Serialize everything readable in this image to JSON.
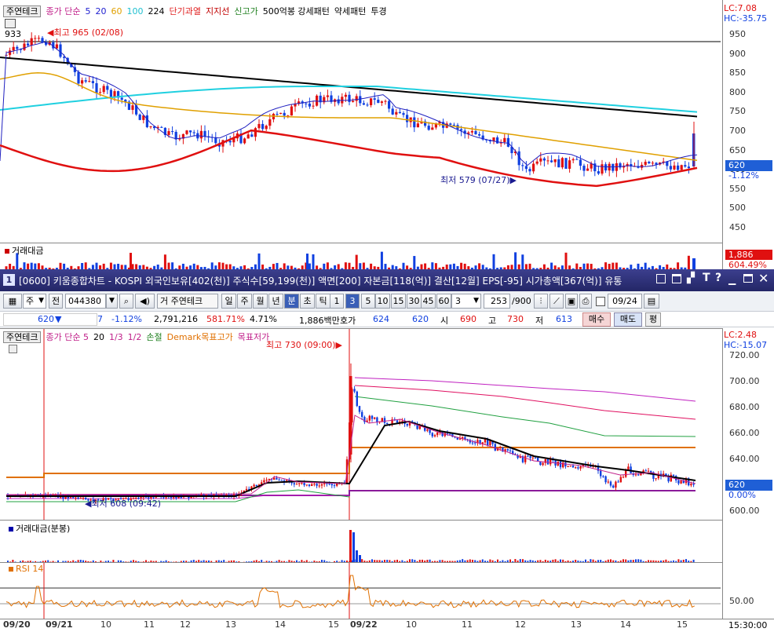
{
  "top_chart": {
    "legend": {
      "button": "주연테크",
      "items": [
        {
          "text": "종가 단순",
          "color": "#c0208a"
        },
        {
          "text": "5",
          "color": "#2020d0"
        },
        {
          "text": "20",
          "color": "#2020d0"
        },
        {
          "text": "60",
          "color": "#e0a000"
        },
        {
          "text": "100",
          "color": "#20c0d0"
        },
        {
          "text": "224",
          "color": "#000000"
        },
        {
          "text": "단기과열",
          "color": "#e02020"
        },
        {
          "text": "지지선",
          "color": "#c00000"
        },
        {
          "text": "신고가",
          "color": "#208020"
        },
        {
          "text": "500억봉 강세패턴",
          "color": "#000000"
        },
        {
          "text": "약세패턴",
          "color": "#000000"
        },
        {
          "text": "투경",
          "color": "#000000"
        }
      ]
    },
    "corner_value": "933",
    "high_label": "최고 965 (02/08)",
    "low_label": "최저 579 (07/27)",
    "lc": "LC:7.08",
    "hc": "HC:-35.75",
    "y_ticks": [
      "950",
      "900",
      "850",
      "800",
      "750",
      "700",
      "650",
      "600",
      "550",
      "500",
      "450"
    ],
    "price_box": "620",
    "pct_label": "-1.12%",
    "volume_title": "거래대금",
    "volume_box": "1,886",
    "volume_pct": "604.49%"
  },
  "window": {
    "number": "1",
    "title": "[0600] 키움종합차트 - KOSPI 외국인보유[402(천)] 주식수[59,199(천)] 액면[200] 자본금[118(억)] 결산[12월] EPS[-95] 시가총액[367(억)] 유통"
  },
  "toolbar": {
    "type_select": "주",
    "prev_btn": "전",
    "code_input": "044380",
    "stock_name": "거 주연테크",
    "period_tabs": [
      "일",
      "주",
      "월",
      "년",
      "분",
      "초",
      "틱"
    ],
    "active_period": "분",
    "minute_tabs": [
      "1",
      "3",
      "5",
      "10",
      "15",
      "30",
      "45",
      "60"
    ],
    "active_minute": "3",
    "count_select": "3",
    "data_count": "253",
    "data_total": "/900",
    "date_input": "09/24"
  },
  "quote": {
    "price": "620",
    "arrow": "▼",
    "change": "7",
    "change_pct": "-1.12%",
    "volume": "2,791,216",
    "vol_ratio": "581.71%",
    "turnover": "4.71%",
    "amount": "1,886백만",
    "bid_label": "호가",
    "bid": "624",
    "ask": "620",
    "open_label": "시",
    "open": "690",
    "high_label": "고",
    "high": "730",
    "low_label": "저",
    "low": "613",
    "buy_button": "매수",
    "sell_button": "매도",
    "eval_button": "평"
  },
  "bottom_chart": {
    "legend": {
      "button": "주연테크",
      "items": [
        {
          "text": "종가 단순 5",
          "color": "#c0208a"
        },
        {
          "text": "20",
          "color": "#000000"
        },
        {
          "text": "1/3",
          "color": "#c0208a"
        },
        {
          "text": "1/2",
          "color": "#c0208a"
        },
        {
          "text": "손절",
          "color": "#208020"
        },
        {
          "text": "Demark목표고가",
          "color": "#e07000"
        },
        {
          "text": "목표저가",
          "color": "#c0208a"
        }
      ]
    },
    "high_label": "최고 730 (09:00)",
    "low_label": "최저 608 (09:42)",
    "lc": "LC:2.48",
    "hc": "HC:-15.07",
    "y_ticks": [
      "720.00",
      "700.00",
      "680.00",
      "660.00",
      "640.00",
      "620",
      "0.00%",
      "600.00"
    ],
    "volume_title": "거래대금(분봉)",
    "rsi_title": "RSI 14",
    "rsi_tick": "50.00",
    "x_labels": [
      "09/20",
      "09/21",
      "10",
      "11",
      "12",
      "13",
      "14",
      "15",
      "09/22",
      "10",
      "11",
      "12",
      "13",
      "14",
      "15"
    ],
    "time_label": "15:30:00"
  },
  "colors": {
    "up": "#e01010",
    "down": "#1040e0",
    "accent": "#3a5fb7"
  }
}
